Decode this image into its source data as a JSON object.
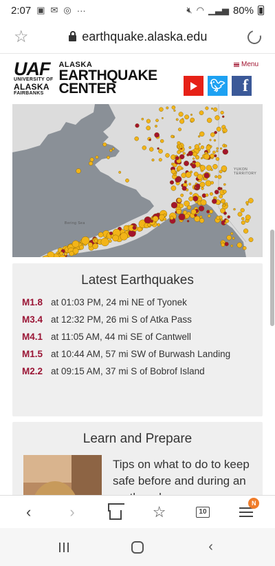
{
  "status_bar": {
    "time": "2:07",
    "notification_icons": [
      "image-icon",
      "mail-icon",
      "instagram-icon",
      "more-icon"
    ],
    "more_text": "···",
    "battery": "80%"
  },
  "browser": {
    "url": "earthquake.alaska.edu"
  },
  "header": {
    "uaf_logo": "UAF",
    "uaf_line1": "UNIVERSITY OF",
    "uaf_line2": "ALASKA",
    "uaf_line3": "FAIRBANKS",
    "center_line1": "ALASKA",
    "center_line2": "EARTHQUAKE",
    "center_line3": "CENTER",
    "menu_label": "Menu",
    "facebook_glyph": "f"
  },
  "map": {
    "label_territory": "YUKON TERRITORY",
    "label_sea": "Bering Sea",
    "land_color": "#dcdcdc",
    "water_color": "#8a9097",
    "quake_color_old": "#f2b418",
    "quake_color_recent": "#a3152c"
  },
  "latest": {
    "title": "Latest Earthquakes",
    "items": [
      {
        "mag": "M1.8",
        "text": "at 01:03 PM, 24 mi NE of Tyonek"
      },
      {
        "mag": "M3.4",
        "text": "at 12:32 PM, 26 mi S of Atka Pass"
      },
      {
        "mag": "M4.1",
        "text": "at 11:05 AM, 44 mi SE of Cantwell"
      },
      {
        "mag": "M1.5",
        "text": "at 10:44 AM, 57 mi SW of Burwash Landing"
      },
      {
        "mag": "M2.2",
        "text": "at 09:15 AM, 37 mi S of Bobrof Island"
      }
    ]
  },
  "learn": {
    "title": "Learn and Prepare",
    "text": "Tips on what to do to keep safe before and during an earthquake."
  },
  "toolbar": {
    "tab_count": "10",
    "notification_badge": "N"
  }
}
